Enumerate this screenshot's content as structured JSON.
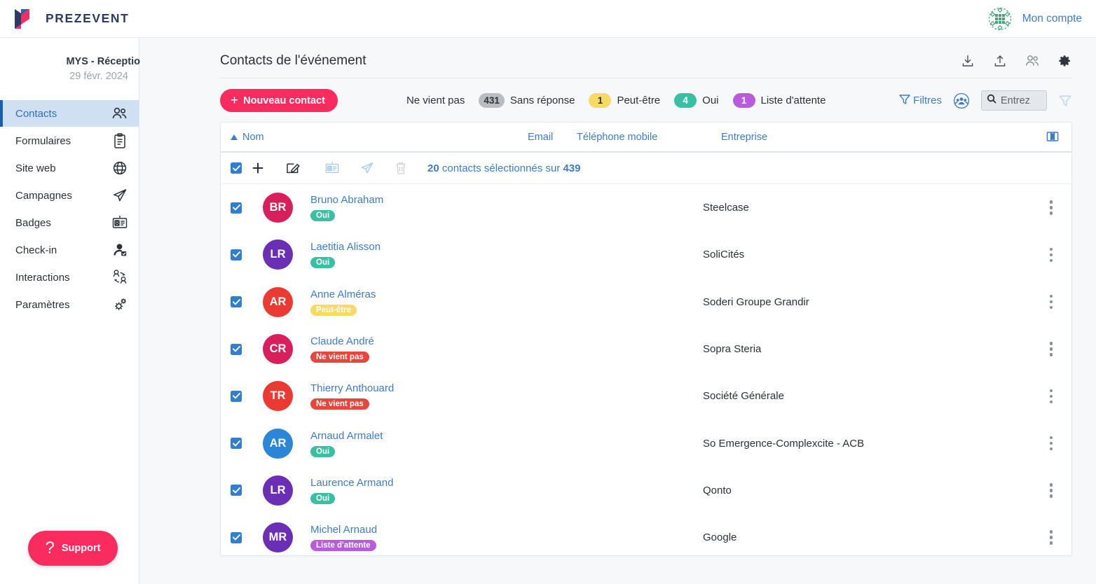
{
  "brand": {
    "name": "PREZEVENT",
    "logo_icon": "prezevent-logo-icon"
  },
  "account": {
    "label": "Mon compte",
    "avatar_icon": "identicon-avatar"
  },
  "sidebar": {
    "event_name": "MYS - Réceptio",
    "event_date": "29 févr. 2024",
    "items": [
      {
        "label": "Contacts",
        "icon": "contacts-icon",
        "active": true
      },
      {
        "label": "Formulaires",
        "icon": "clipboard-icon",
        "active": false
      },
      {
        "label": "Site web",
        "icon": "globe-icon",
        "active": false
      },
      {
        "label": "Campagnes",
        "icon": "paper-plane-icon",
        "active": false
      },
      {
        "label": "Badges",
        "icon": "badge-card-icon",
        "active": false
      },
      {
        "label": "Check-in",
        "icon": "person-check-icon",
        "active": false
      },
      {
        "label": "Interactions",
        "icon": "interactions-icon",
        "active": false
      },
      {
        "label": "Paramètres",
        "icon": "gear-icon",
        "active": false
      }
    ],
    "support": {
      "label": "Support",
      "icon": "question-mark-icon"
    }
  },
  "header": {
    "title": "Contacts de l'événement",
    "actions": [
      {
        "name": "download-icon",
        "title": "Télécharger"
      },
      {
        "name": "upload-icon",
        "title": "Importer"
      },
      {
        "name": "users-icon",
        "title": "Participants"
      },
      {
        "name": "gear-icon",
        "title": "Paramètres"
      }
    ]
  },
  "toolbar": {
    "new_contact_label": "Nouveau contact",
    "new_contact_plus": "+",
    "statuses": [
      {
        "label": "Ne vient pas",
        "count": "",
        "color": "",
        "show_badge": false
      },
      {
        "label": "Sans réponse",
        "count": "431",
        "color": "#b9bdc2",
        "show_badge": true
      },
      {
        "label": "Peut-être",
        "count": "1",
        "color": "#f7da63",
        "show_badge": true
      },
      {
        "label": "Oui",
        "count": "4",
        "color": "#3bbfa3",
        "show_badge": true
      },
      {
        "label": "Liste d'attente",
        "count": "1",
        "color": "#b95cdb",
        "show_badge": true
      }
    ],
    "filters_label": "Filtres",
    "filters_icon": "funnel-icon",
    "group_icon": "group-circle-icon",
    "search_placeholder": "Entrez",
    "search_value": "",
    "search_icon": "search-icon",
    "secondary_funnel_icon": "funnel-icon"
  },
  "table": {
    "columns": [
      {
        "label": "Nom",
        "sorted": "asc"
      },
      {
        "label": "Email"
      },
      {
        "label": "Téléphone mobile"
      },
      {
        "label": "Entreprise"
      }
    ],
    "column_toggle_icon": "columns-layout-icon",
    "selection": {
      "checked": true,
      "add_icon": "plus-icon",
      "edit_icon": "edit-pencil-icon",
      "badge_icon": "badge-card-icon",
      "send_icon": "paper-plane-icon",
      "delete_icon": "trash-icon",
      "selected_count": "20",
      "text_middle": " contacts sélectionnés sur ",
      "total_count": "439"
    },
    "rows": [
      {
        "checked": true,
        "initials": "BR",
        "avatar_color": "#d81e5b",
        "name": "Bruno Abraham",
        "status": "Oui",
        "status_color": "#3bbfa3",
        "company": "Steelcase"
      },
      {
        "checked": true,
        "initials": "LR",
        "avatar_color": "#6b2fb5",
        "name": "Laetitia Alisson",
        "status": "Oui",
        "status_color": "#3bbfa3",
        "company": "SoliCités"
      },
      {
        "checked": true,
        "initials": "AR",
        "avatar_color": "#ea3a32",
        "name": "Anne Alméras",
        "status": "Peut-être",
        "status_color": "#f7da63",
        "company": "Soderi Groupe Grandir"
      },
      {
        "checked": true,
        "initials": "CR",
        "avatar_color": "#d81e5b",
        "name": "Claude André",
        "status": "Ne vient pas",
        "status_color": "#e8453c",
        "company": "Sopra Steria"
      },
      {
        "checked": true,
        "initials": "TR",
        "avatar_color": "#ea3a32",
        "name": "Thierry Anthouard",
        "status": "Ne vient pas",
        "status_color": "#e8453c",
        "company": "Société Générale"
      },
      {
        "checked": true,
        "initials": "AR",
        "avatar_color": "#2b86d8",
        "name": "Arnaud Armalet",
        "status": "Oui",
        "status_color": "#3bbfa3",
        "company": "So Emergence-Complexcite - ACB"
      },
      {
        "checked": true,
        "initials": "LR",
        "avatar_color": "#6b2fb5",
        "name": "Laurence Armand",
        "status": "Oui",
        "status_color": "#3bbfa3",
        "company": "Qonto"
      },
      {
        "checked": true,
        "initials": "MR",
        "avatar_color": "#6b2fb5",
        "name": "Michel Arnaud",
        "status": "Liste d'attente",
        "status_color": "#b95cdb",
        "company": "Google"
      }
    ]
  },
  "colors": {
    "brand_pink": "#fa2b5f",
    "brand_navy": "#2b3a67",
    "link_blue": "#3f7cc4",
    "active_nav_bg": "#cfe0f3"
  }
}
